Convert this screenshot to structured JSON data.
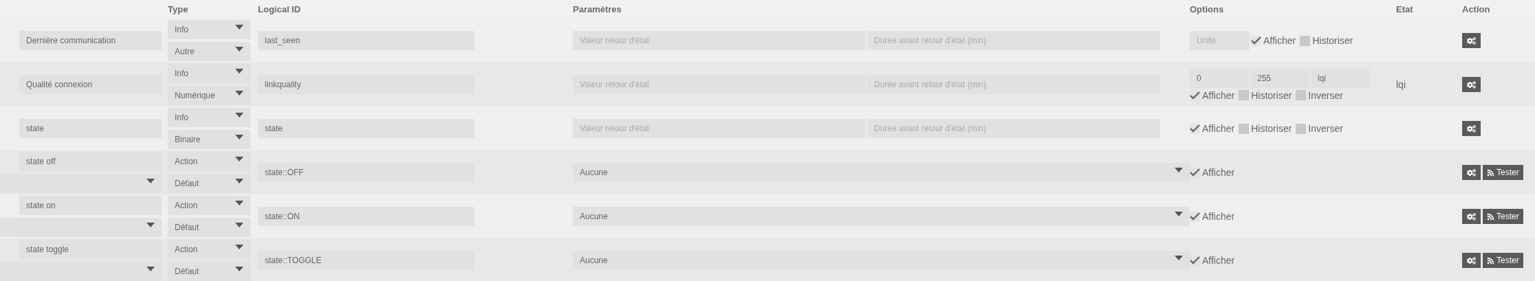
{
  "columns": [
    "Type",
    "Logical ID",
    "Paramètres",
    "Options",
    "Etat",
    "Action"
  ],
  "rows": [
    {
      "kind": "info",
      "name": "Dernière communication",
      "type": "Info",
      "subtype": "Autre",
      "logical_id": "last_seen",
      "params": [
        {
          "placeholder": "Valeur retour d'état"
        },
        {
          "placeholder": "Durée avant retour d'état (min)"
        }
      ],
      "option_fields": [
        {
          "placeholder": "Unité"
        }
      ],
      "checkboxes": [
        {
          "label": "Afficher",
          "checked": true
        },
        {
          "label": "Historiser",
          "checked": false
        }
      ],
      "buttons": [
        {
          "kind": "config"
        }
      ]
    },
    {
      "kind": "info",
      "name": "Qualité connexion",
      "type": "Info",
      "subtype": "Numérique",
      "logical_id": "linkquality",
      "params": [
        {
          "placeholder": "Valeur retour d'état"
        },
        {
          "placeholder": "Durée avant retour d'état (min)"
        }
      ],
      "option_fields": [
        {
          "value": "0"
        },
        {
          "value": "255"
        },
        {
          "value": "lqi"
        }
      ],
      "checkboxes": [
        {
          "label": "Afficher",
          "checked": true
        },
        {
          "label": "Historiser",
          "checked": false
        },
        {
          "label": "Inverser",
          "checked": false
        }
      ],
      "etat": "lqi",
      "buttons": [
        {
          "kind": "config"
        }
      ]
    },
    {
      "kind": "info",
      "name": "state",
      "type": "Info",
      "subtype": "Binaire",
      "logical_id": "state",
      "params": [
        {
          "placeholder": "Valeur retour d'état"
        },
        {
          "placeholder": "Durée avant retour d'état (min)"
        }
      ],
      "checkboxes": [
        {
          "label": "Afficher",
          "checked": true
        },
        {
          "label": "Historiser",
          "checked": false
        },
        {
          "label": "Inverser",
          "checked": false
        }
      ],
      "buttons": [
        {
          "kind": "config"
        }
      ]
    },
    {
      "kind": "action",
      "name": "state off",
      "type": "Action",
      "subtype": "Défaut",
      "logical_id": "state::OFF",
      "value_select": "Aucune",
      "checkboxes": [
        {
          "label": "Afficher",
          "checked": true
        }
      ],
      "buttons": [
        {
          "kind": "config"
        },
        {
          "kind": "test",
          "label": "Tester"
        }
      ]
    },
    {
      "kind": "action",
      "name": "state on",
      "type": "Action",
      "subtype": "Défaut",
      "logical_id": "state::ON",
      "value_select": "Aucune",
      "checkboxes": [
        {
          "label": "Afficher",
          "checked": true
        }
      ],
      "buttons": [
        {
          "kind": "config"
        },
        {
          "kind": "test",
          "label": "Tester"
        }
      ]
    },
    {
      "kind": "action",
      "name": "state toggle",
      "type": "Action",
      "subtype": "Défaut",
      "logical_id": "state::TOGGLE",
      "value_select": "Aucune",
      "checkboxes": [
        {
          "label": "Afficher",
          "checked": true
        }
      ],
      "buttons": [
        {
          "kind": "config"
        },
        {
          "kind": "test",
          "label": "Tester"
        }
      ]
    }
  ]
}
